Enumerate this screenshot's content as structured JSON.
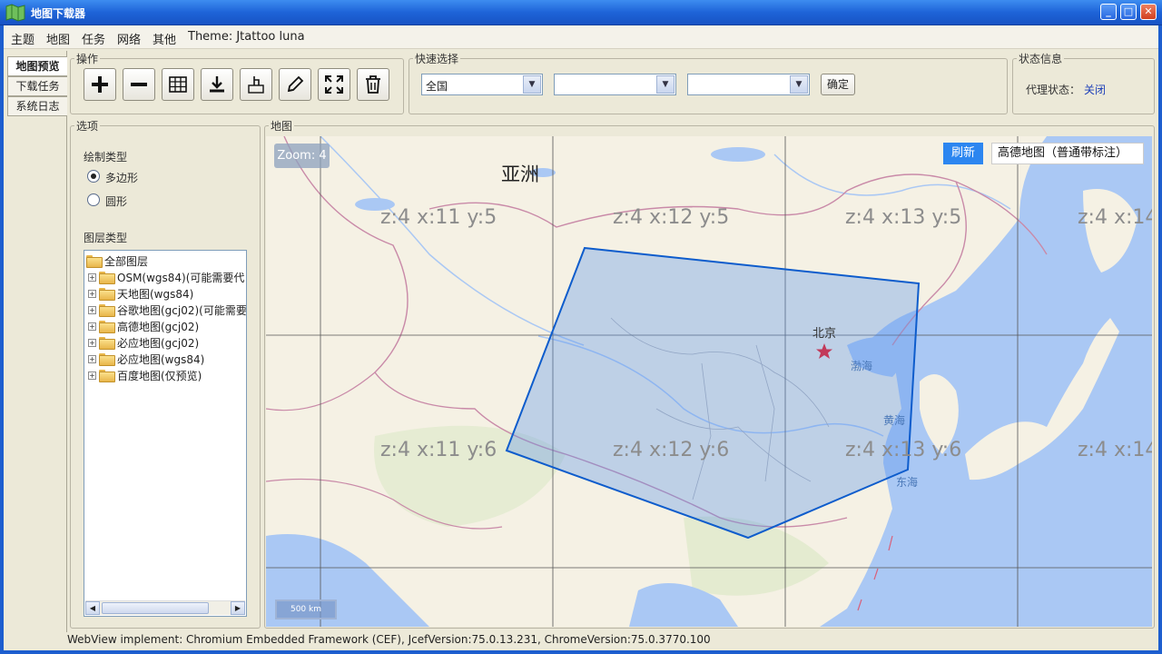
{
  "window": {
    "title": "地图下载器"
  },
  "menu": [
    "主题",
    "地图",
    "任务",
    "网络",
    "其他",
    "Theme: Jtattoo luna"
  ],
  "side_tabs": [
    {
      "label": "地图预览",
      "active": true
    },
    {
      "label": "下载任务",
      "active": false
    },
    {
      "label": "系统日志",
      "active": false
    }
  ],
  "operations": {
    "legend": "操作",
    "tools": [
      "add-icon",
      "minus-icon",
      "grid-icon",
      "download-icon",
      "hand-select-icon",
      "pencil-icon",
      "fullscreen-icon",
      "trash-icon"
    ]
  },
  "quick_select": {
    "legend": "快速选择",
    "combo1": "全国",
    "combo2": "",
    "combo3": "",
    "confirm": "确定"
  },
  "status_info": {
    "legend": "状态信息",
    "proxy_label": "代理状态：",
    "proxy_value": "关闭"
  },
  "options": {
    "legend": "选项",
    "draw_type_label": "绘制类型",
    "draw_types": [
      {
        "label": "多边形",
        "checked": true
      },
      {
        "label": "圆形",
        "checked": false
      }
    ],
    "layer_type_label": "图层类型",
    "layer_root": "全部图层",
    "layers": [
      "OSM(wgs84)(可能需要代",
      "天地图(wgs84)",
      "谷歌地图(gcj02)(可能需要",
      "高德地图(gcj02)",
      "必应地图(gcj02)",
      "必应地图(wgs84)",
      "百度地图(仅预览)"
    ]
  },
  "map": {
    "legend": "地图",
    "zoom": "Zoom: 4",
    "continent": "亚洲",
    "refresh": "刷新",
    "layer": "高德地图（普通带标注）",
    "city": "北京",
    "seas": [
      "渤海",
      "黄海",
      "东海"
    ],
    "scale": "500 km",
    "tile_labels": [
      "z:4 x:11 y:5",
      "z:4 x:12 y:5",
      "z:4 x:13 y:5",
      "z:4 x:14",
      "z:4 x:11 y:6",
      "z:4 x:12 y:6",
      "z:4 x:13 y:6",
      "z:4 x:14"
    ]
  },
  "footer": "WebView implement: Chromium Embedded Framework (CEF), JcefVersion:75.0.13.231, ChromeVersion:75.0.3770.100"
}
